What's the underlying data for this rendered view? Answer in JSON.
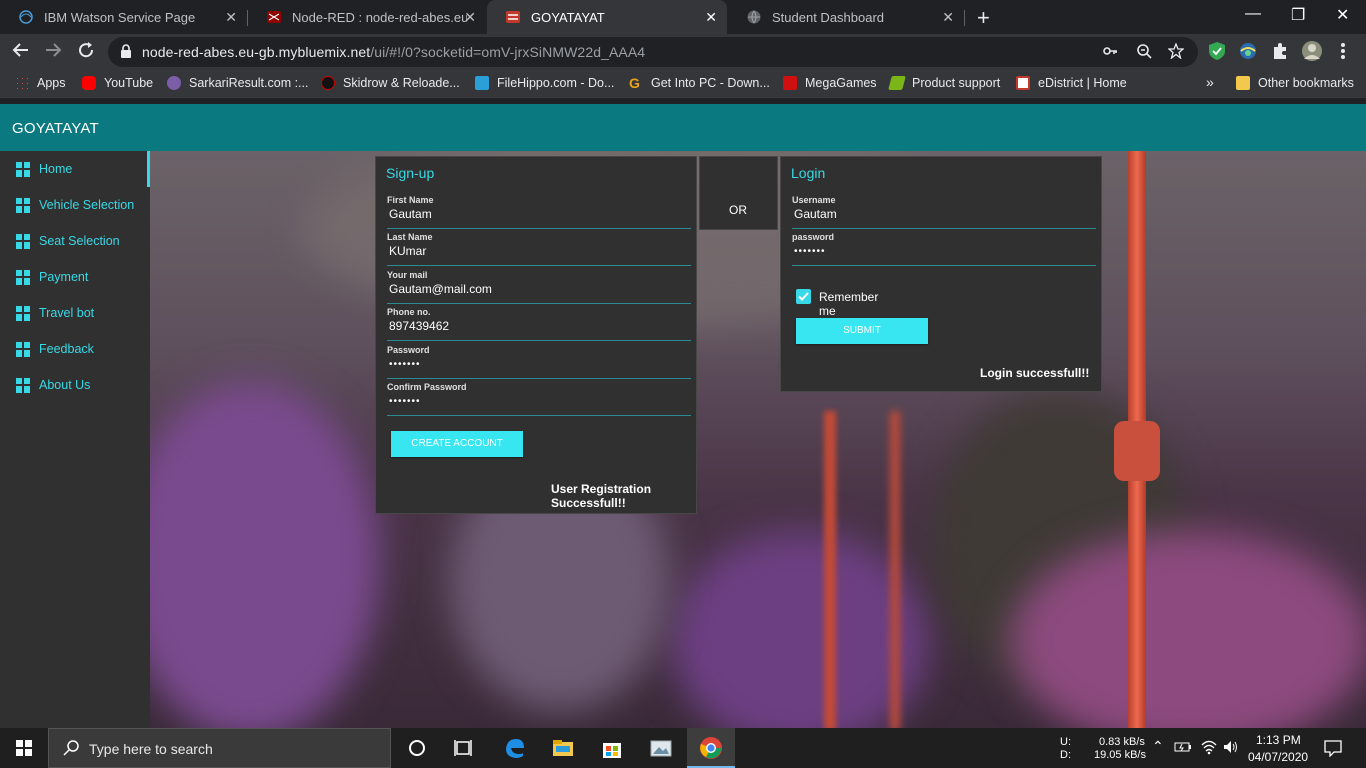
{
  "browser": {
    "tabs": [
      {
        "title": "IBM Watson Service Page",
        "active": false
      },
      {
        "title": "Node-RED : node-red-abes.eu-gb",
        "active": false
      },
      {
        "title": "GOYATAYAT",
        "active": true
      },
      {
        "title": "Student Dashboard",
        "active": false
      }
    ],
    "url_domain": "node-red-abes.eu-gb.mybluemix.net",
    "url_path": "/ui/#!/0?socketid=omV-jrxSiNMW22d_AAA4",
    "bookmarks": [
      {
        "label": "Apps",
        "color": "#ea4335"
      },
      {
        "label": "YouTube",
        "color": "#ff0000"
      },
      {
        "label": "SarkariResult.com :...",
        "color": "#7b5ea7"
      },
      {
        "label": "Skidrow & Reloade...",
        "color": "#222222"
      },
      {
        "label": "FileHippo.com - Do...",
        "color": "#2a9fd8"
      },
      {
        "label": "Get Into PC - Down...",
        "color": "#e8a317"
      },
      {
        "label": "MegaGames",
        "color": "#d01010"
      },
      {
        "label": "Product support",
        "color": "#7cb518"
      },
      {
        "label": "eDistrict | Home",
        "color": "#c0392b"
      }
    ],
    "other_bookmarks": "Other bookmarks",
    "more_bookmarks": "»"
  },
  "app": {
    "title": "GOYATAYAT",
    "accent": "#37d9e6",
    "header_color": "#0a7a80"
  },
  "sidebar": {
    "items": [
      {
        "label": "Home",
        "active": true
      },
      {
        "label": "Vehicle Selection"
      },
      {
        "label": "Seat Selection"
      },
      {
        "label": "Payment"
      },
      {
        "label": "Travel bot"
      },
      {
        "label": "Feedback"
      },
      {
        "label": "About Us"
      }
    ]
  },
  "signup": {
    "title": "Sign-up",
    "fields": [
      {
        "label": "First Name",
        "value": "Gautam"
      },
      {
        "label": "Last Name",
        "value": "KUmar"
      },
      {
        "label": "Your mail",
        "value": "Gautam@mail.com"
      },
      {
        "label": "Phone no.",
        "value": "897439462"
      },
      {
        "label": "Password",
        "value": "•••••••"
      },
      {
        "label": "Confirm Password",
        "value": "•••••••"
      }
    ],
    "button": "CREATE ACCOUNT",
    "message": "User Registration Successfull!!"
  },
  "or_label": "OR",
  "login": {
    "title": "Login",
    "fields": [
      {
        "label": "Username",
        "value": "Gautam"
      },
      {
        "label": "password",
        "value": "•••••••"
      }
    ],
    "remember_label": "Remember me",
    "remember_checked": true,
    "button": "SUBMIT",
    "message": "Login successfull!!"
  },
  "taskbar": {
    "search_placeholder": "Type here to search",
    "upload_label": "U:",
    "download_label": "D:",
    "upload_speed": "0.83 kB/s",
    "download_speed": "19.05 kB/s",
    "time": "1:13 PM",
    "date": "04/07/2020"
  }
}
